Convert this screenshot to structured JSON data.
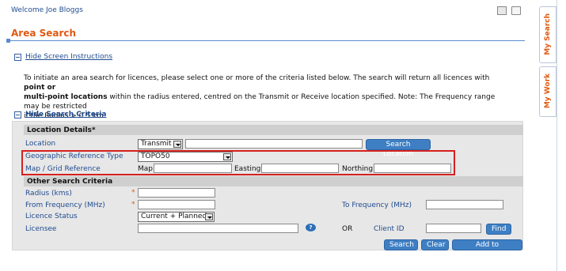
{
  "header": {
    "welcome": "Welcome Joe Bloggs",
    "print_icon": "print-icon",
    "cart_icon": "cart-icon"
  },
  "page": {
    "title": "Area Search"
  },
  "instructions": {
    "toggle_label": "Hide Screen Instructions",
    "text_1": "To initiate an area search for licences, please select one or more of the criteria listed below. The search will return all licences with ",
    "bold_1": "point or",
    "bold_2": "multi-point locations",
    "text_2": " within the radius entered, centred on the Transmit or Receive location specified. Note: The Frequency range may be restricted",
    "text_3": "if the Radius > 0.5 km."
  },
  "criteria": {
    "toggle_label": "Hide Search Criteria",
    "location_details": "Location Details",
    "location_details_req": "*",
    "location_label": "Location",
    "location_select": "Transmit",
    "search_location_button": "Search Location",
    "geo_ref_label": "Geographic Reference Type",
    "geo_ref_select": "TOPO50",
    "map_grid_label": "Map / Grid Reference",
    "map_label": "Map",
    "easting_label": "Easting",
    "northing_label": "Northing",
    "other_criteria": "Other Search Criteria",
    "radius_label": "Radius (kms)",
    "from_freq_label": "From Frequency (MHz)",
    "to_freq_label": "To Frequency (MHz)",
    "required_marker": "*",
    "licence_status_label": "Licence Status",
    "licence_status_select": "Current + Planned",
    "licensee_label": "Licensee",
    "or_label": "OR",
    "client_id_label": "Client ID",
    "find_button": "Find",
    "help_glyph": "?"
  },
  "actions": {
    "search": "Search",
    "clear": "Clear",
    "add_favourites": "Add to Favourites"
  },
  "side_tabs": {
    "my_search": "My Search",
    "my_work": "My Work"
  },
  "colors": {
    "accent_orange": "#e05a12",
    "link_blue": "#1f4b8f",
    "button_blue": "#3e7fc4",
    "highlight_red": "#d6201e"
  }
}
